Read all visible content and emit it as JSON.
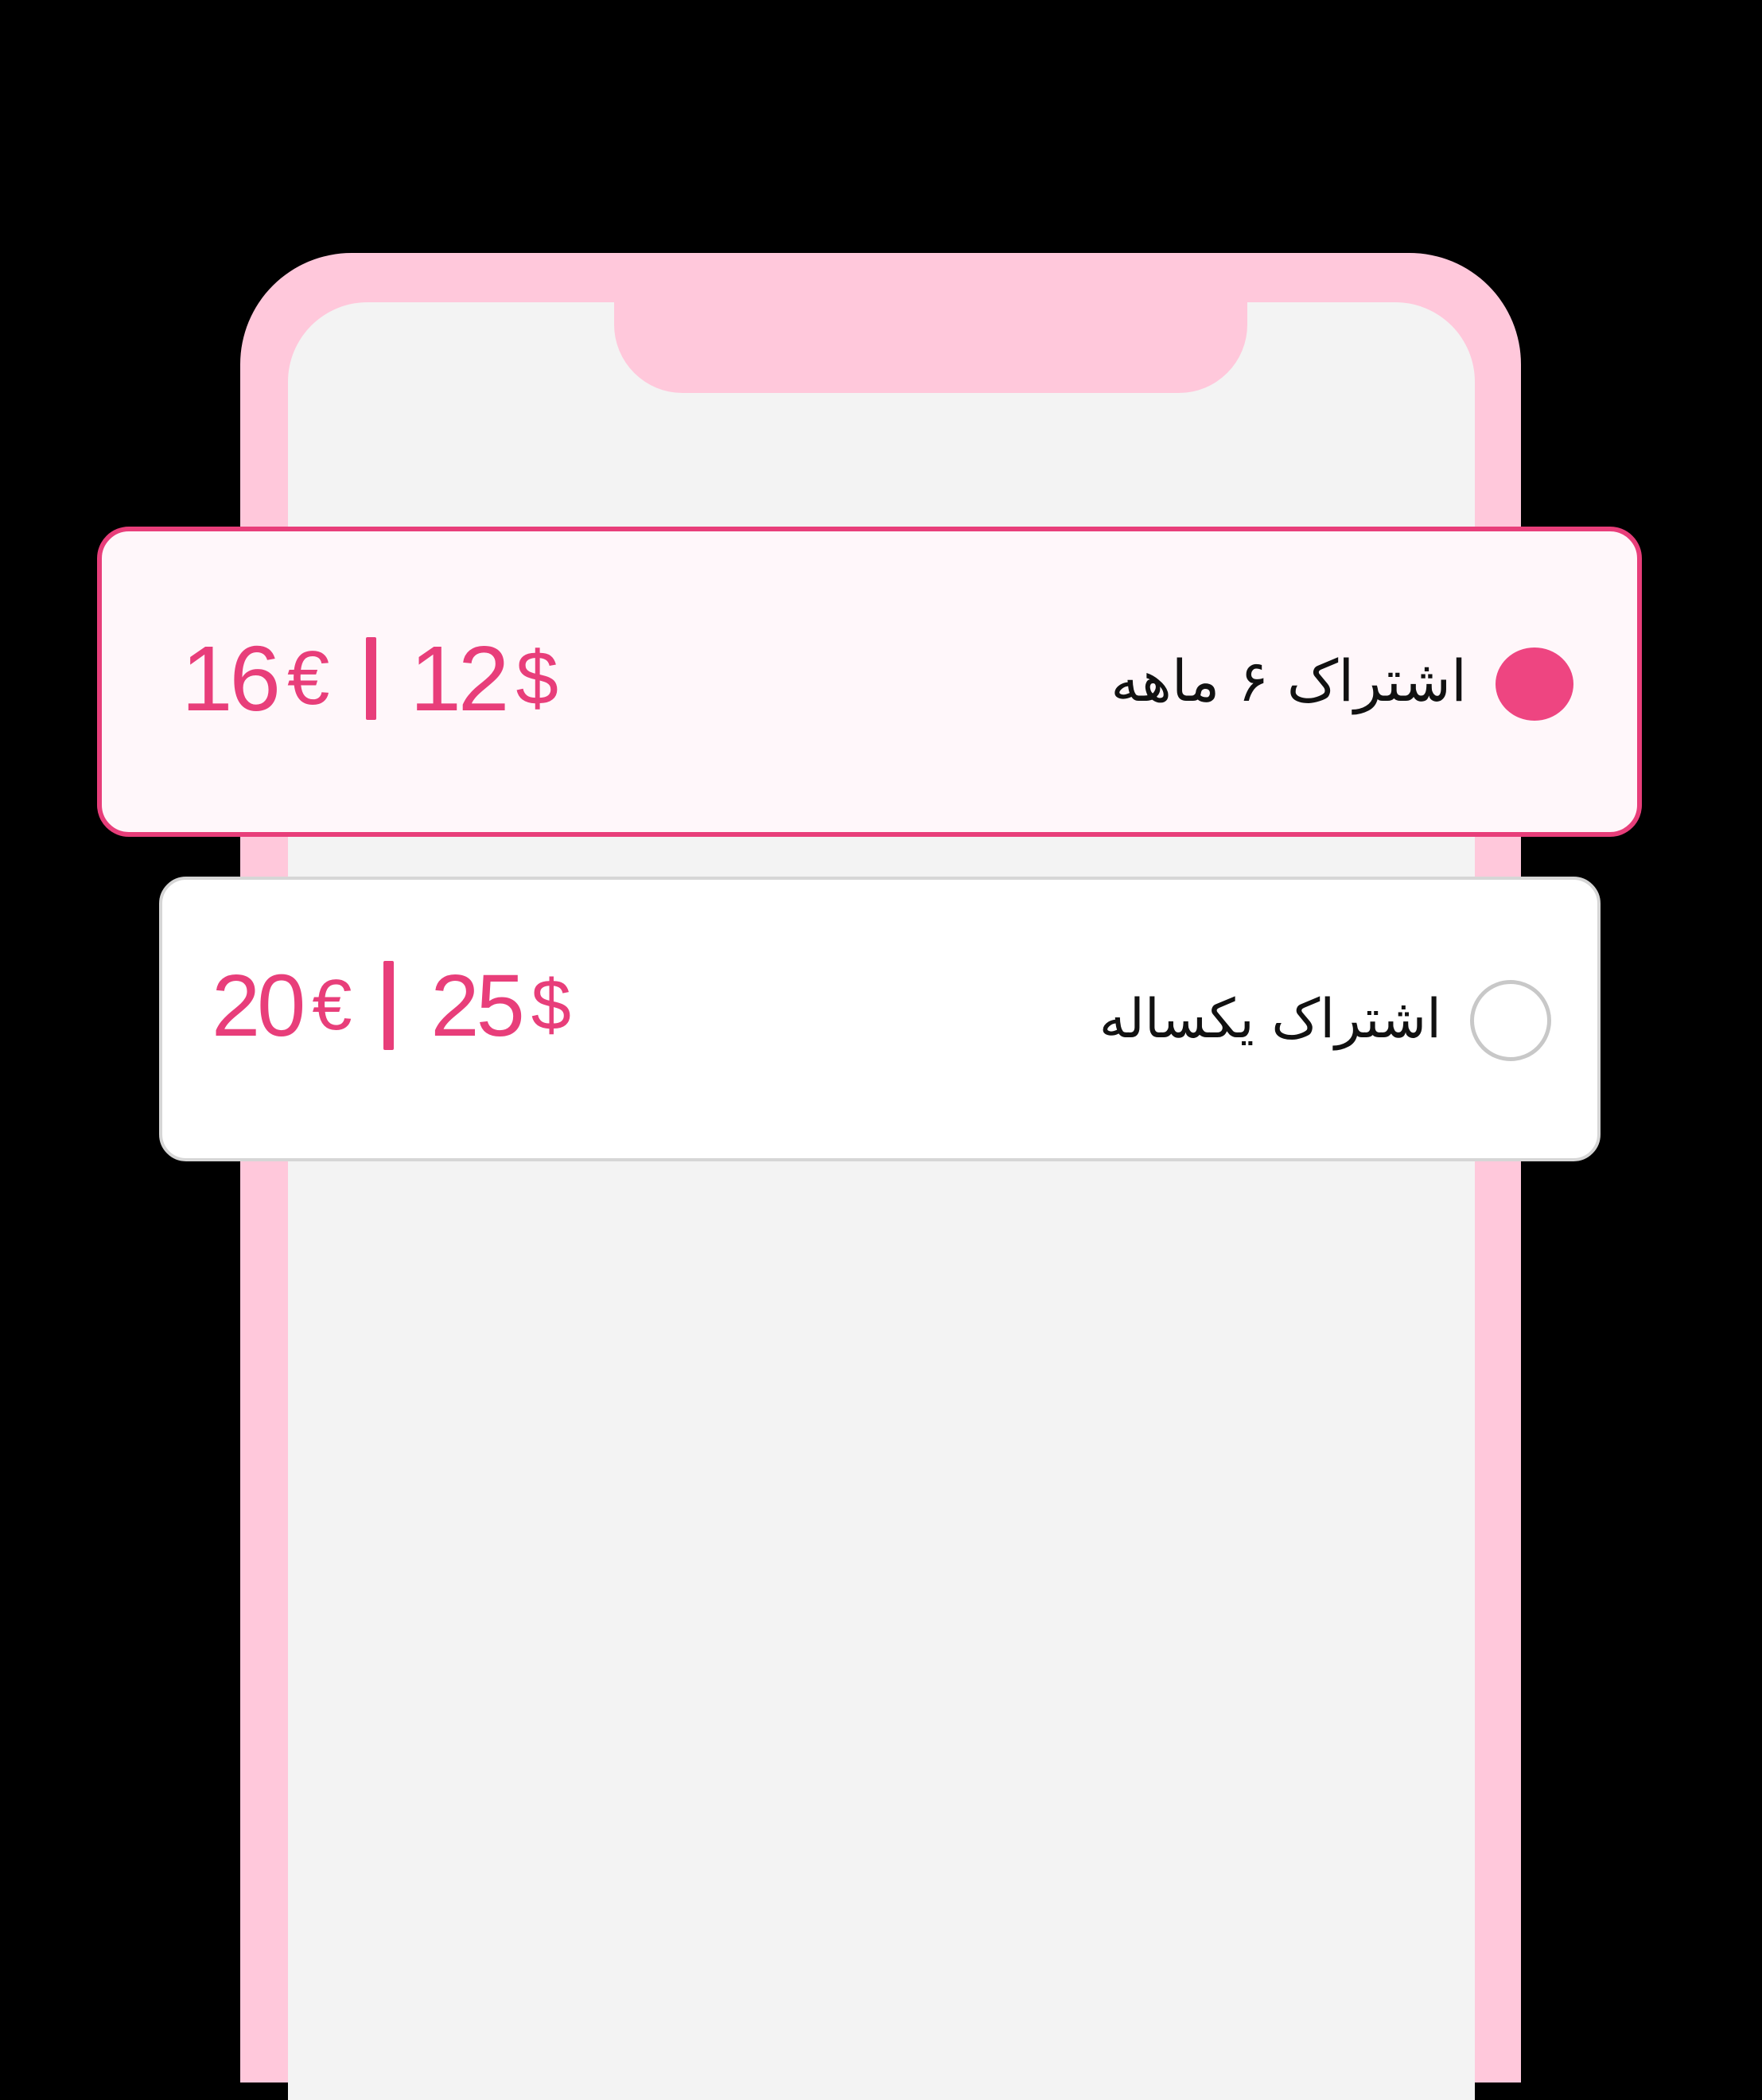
{
  "colors": {
    "accent": "#E83E7A",
    "frame": "#FFC8DB",
    "screen": "#F3F3F3",
    "background": "#000000"
  },
  "plans": [
    {
      "name": "اشتراک ۶ ماهه",
      "selected": true,
      "price_eur": "16",
      "eur_symbol": "€",
      "price_usd": "12",
      "usd_symbol": "$"
    },
    {
      "name": "اشتراک یکساله",
      "selected": false,
      "price_eur": "20",
      "eur_symbol": "€",
      "price_usd": "25",
      "usd_symbol": "$"
    }
  ]
}
